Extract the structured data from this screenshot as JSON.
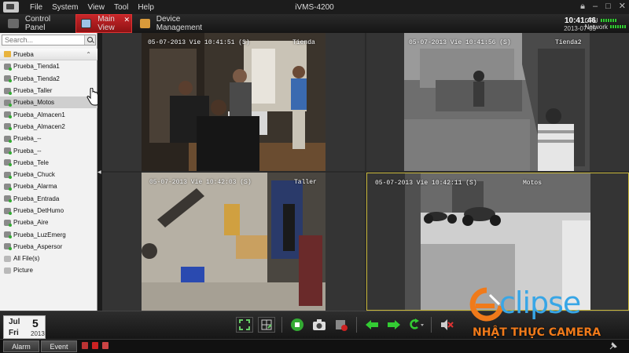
{
  "menubar": {
    "items": [
      "File",
      "System",
      "View",
      "Tool",
      "Help"
    ],
    "title": "iVMS-4200"
  },
  "tabs": {
    "control_panel": "Control Panel",
    "main_view": "Main View",
    "device_management": "Device Management"
  },
  "clock": {
    "time": "10:41:46",
    "date": "2013-07-05"
  },
  "meters": {
    "cpu": "CPU",
    "network": "Network"
  },
  "search": {
    "placeholder": "Search..."
  },
  "tree": {
    "group": "Prueba",
    "cameras": [
      "Prueba_Tienda1",
      "Prueba_Tienda2",
      "Prueba_Taller",
      "Prueba_Motos",
      "Prueba_Almacen1",
      "Prueba_Almacen2",
      "Prueba_--",
      "Prueba_--",
      "Prueba_Tele",
      "Prueba_Chuck",
      "Prueba_Alarma",
      "Prueba_Entrada",
      "Prueba_DetHumo",
      "Prueba_Aire",
      "Prueba_LuzEmerg",
      "Prueba_Aspersor"
    ],
    "extras": [
      "All File(s)",
      "Picture"
    ],
    "selected_index": 3
  },
  "panes": [
    {
      "osd": "05-07-2013 Vie 10:41:51 (S)",
      "cam": "Tienda"
    },
    {
      "osd": "05-07-2013 Vie 10:41:56 (S)",
      "cam": "Tienda2"
    },
    {
      "osd": "05-07-2013 Vie 10:42:03 (S)",
      "cam": "Taller"
    },
    {
      "osd": "05-07-2013 Vie 10:42:11 (S)",
      "cam": "Motos"
    }
  ],
  "calendar": {
    "month": "Jul",
    "day": "5",
    "dow": "Fri",
    "year": "2013"
  },
  "status": {
    "alarm": "Alarm",
    "event": "Event"
  },
  "watermark": {
    "brand": "clipse",
    "sub": "NHẬT THỰC CAMERA"
  },
  "colors": {
    "accent": "#c8262a",
    "selection_border": "#c9b73a",
    "brand": "#38a6e6",
    "brand_sub": "#f07a1a"
  }
}
